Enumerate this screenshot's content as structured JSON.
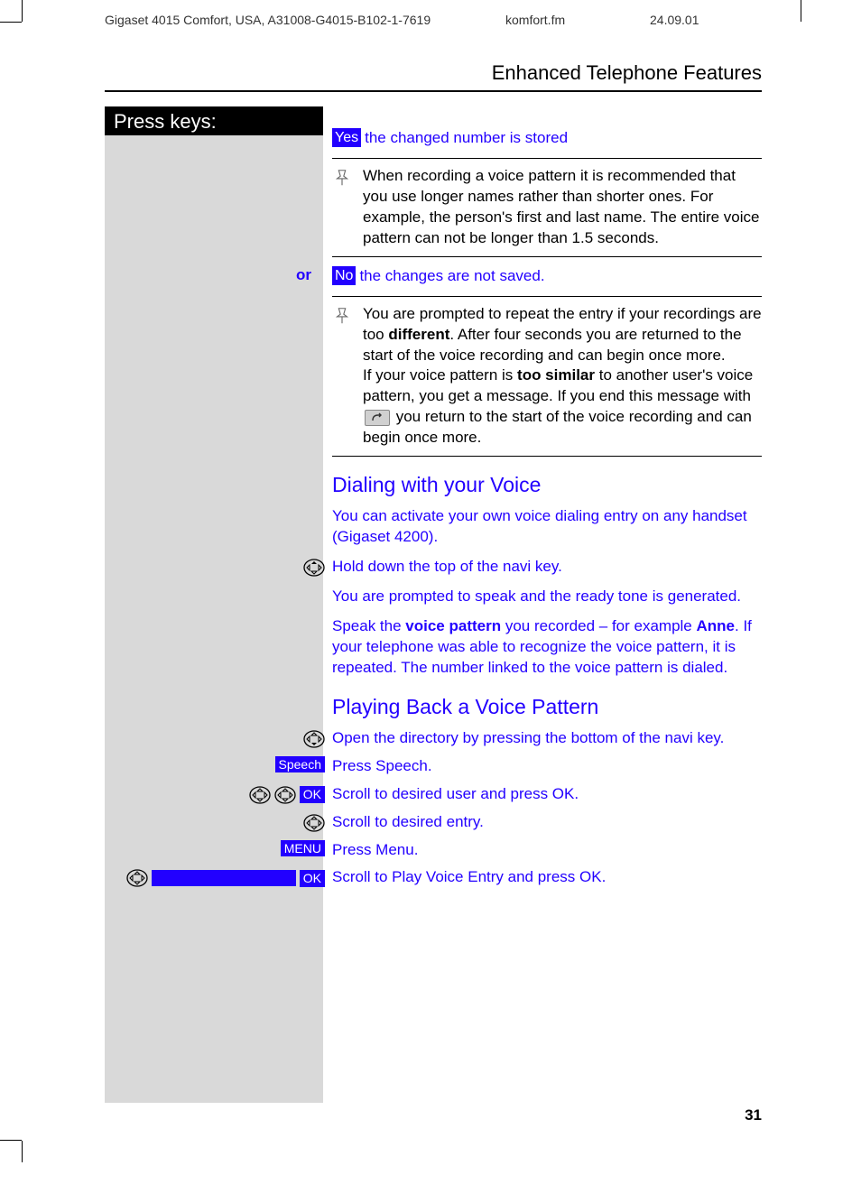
{
  "header": {
    "left": "Gigaset 4015 Comfort, USA, A31008-G4015-B102-1-7619",
    "center": "komfort.fm",
    "right": "24.09.01"
  },
  "page_title": "Enhanced Telephone Features",
  "press_keys": "Press keys:",
  "yes_label": "Yes",
  "yes_text": " the changed number is stored",
  "note1": "When recording a voice pattern it is recommended that you use longer names rather than shorter ones.  For example, the person's first and last name.  The entire voice pattern can not be longer than 1.5 seconds.",
  "or_label": "or",
  "no_label": "No",
  "no_text": " the changes are not saved.",
  "note2a": "You are prompted to repeat the entry if your recordings are too ",
  "note2b": "different",
  "note2c": ". After four seconds you are returned to the start of the voice recording and can begin once more.",
  "note2d": "If your voice pattern is ",
  "note2e": "too similar",
  "note2f": " to another user's voice pattern, you get a message. If you end this message with ",
  "note2g": " you return to the start of the voice recording and can begin once more.",
  "section1_heading": "Dialing with your Voice",
  "section1_p1": "You can activate your own voice dialing entry on any handset (Gigaset 4200).",
  "section1_p2": "Hold down the top of the navi key.",
  "section1_p3": "You are prompted to speak and the ready tone is generated.",
  "section1_p4a": "Speak the ",
  "section1_p4b": "voice pattern",
  "section1_p4c": " you recorded – for example ",
  "section1_p4d": "Anne",
  "section1_p4e": ". If your telephone was able to recognize the voice pattern, it is repeated. The number linked to the voice pattern is dialed.",
  "section2_heading": "Playing Back a Voice Pattern",
  "section2_s1": "Open the directory by pressing the bottom of the navi key.",
  "speech_label": "Speech",
  "section2_s2": "Press Speech.",
  "ok_label": "OK",
  "section2_s3": "Scroll to desired user and press OK.",
  "section2_s4": "Scroll to desired entry.",
  "menu_label": "MENU",
  "section2_s5": "Press Menu.",
  "section2_s6": "Scroll to Play Voice Entry and press OK.",
  "page_number": "31"
}
